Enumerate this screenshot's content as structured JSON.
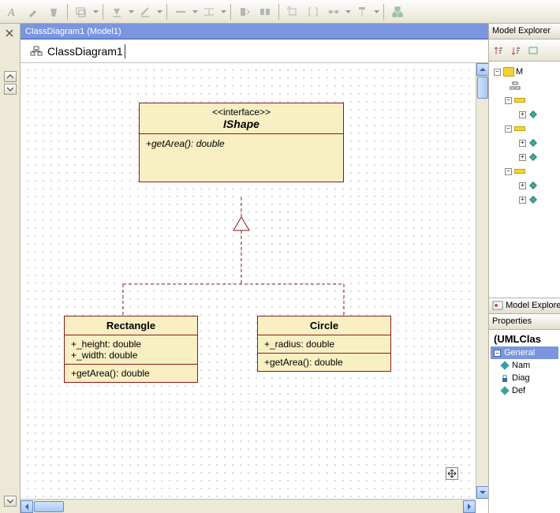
{
  "tab": {
    "title": "ClassDiagram1 (Model1)"
  },
  "doc": {
    "title": "ClassDiagram1"
  },
  "uml": {
    "ishape": {
      "stereotype": "<<interface>>",
      "name": "IShape",
      "op1": "+getArea(): double"
    },
    "rectangle": {
      "name": "Rectangle",
      "attr1": "+_height: double",
      "attr2": "+_width: double",
      "op1": "+getArea(): double"
    },
    "circle": {
      "name": "Circle",
      "attr1": "+_radius: double",
      "op1": "+getArea(): double"
    }
  },
  "explorer": {
    "header": "Model Explorer",
    "collapsed_header": "Model Explorer",
    "root": "M"
  },
  "properties": {
    "header": "Properties",
    "title": "(UMLClas",
    "category": "General",
    "p1": "Nam",
    "p2": "Diag",
    "p3": "Def"
  }
}
